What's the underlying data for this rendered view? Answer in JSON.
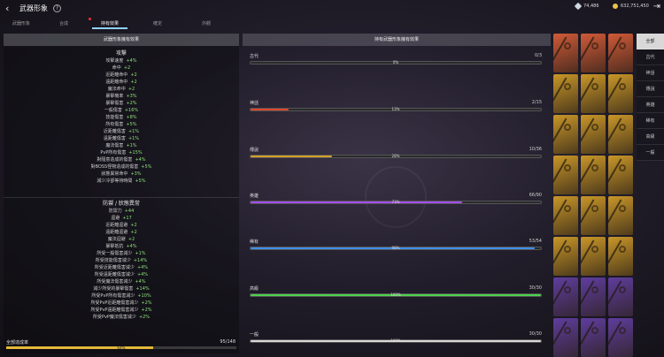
{
  "header": {
    "title": "武器形象",
    "back_icon": "‹",
    "help_icon": "?"
  },
  "currency": [
    {
      "value": "74,486",
      "color": "#cfd8e0",
      "icon": "diamond-icon"
    },
    {
      "value": "632,751,450",
      "color": "#e8c44a",
      "icon": "coin-icon"
    }
  ],
  "tabs": [
    {
      "label": "武器形象",
      "active": false
    },
    {
      "label": "合成",
      "active": false
    },
    {
      "label": "持有效果",
      "active": true
    },
    {
      "label": "確定",
      "active": false
    },
    {
      "label": "外觀",
      "active": false
    }
  ],
  "left_panel": {
    "header": "武器形象擁有效果",
    "attack_title": "攻擊",
    "attack_stats": [
      {
        "name": "攻擊速度",
        "value": "+4%"
      },
      {
        "name": "命中",
        "value": "+2"
      },
      {
        "name": "近距離命中",
        "value": "+2"
      },
      {
        "name": "遠距離命中",
        "value": "+2"
      },
      {
        "name": "魔法命中",
        "value": "+2"
      },
      {
        "name": "暴擊機率",
        "value": "+3%"
      },
      {
        "name": "暴擊傷害",
        "value": "+2%"
      },
      {
        "name": "一般傷害",
        "value": "+16%"
      },
      {
        "name": "技能傷害",
        "value": "+8%"
      },
      {
        "name": "所有傷害",
        "value": "+5%"
      },
      {
        "name": "近距離傷害",
        "value": "+1%"
      },
      {
        "name": "遠距離傷害",
        "value": "+1%"
      },
      {
        "name": "魔法傷害",
        "value": "+1%"
      },
      {
        "name": "PvP所有傷害",
        "value": "+15%"
      },
      {
        "name": "對隨意造成的傷害",
        "value": "+4%"
      },
      {
        "name": "對BOSS怪物造成的傷害",
        "value": "+5%"
      },
      {
        "name": "狀態異常命中",
        "value": "+3%"
      },
      {
        "name": "減少冷卻等待時間",
        "value": "+5%"
      }
    ],
    "defense_title": "防禦 / 狀態異常",
    "defense_stats": [
      {
        "name": "防禦力",
        "value": "+44"
      },
      {
        "name": "迴避",
        "value": "+17"
      },
      {
        "name": "近距離迴避",
        "value": "+2"
      },
      {
        "name": "遠距離迴避",
        "value": "+2"
      },
      {
        "name": "魔法迴避",
        "value": "+2"
      },
      {
        "name": "暴擊抵抗",
        "value": "+4%"
      },
      {
        "name": "所受一般傷害減少",
        "value": "+1%"
      },
      {
        "name": "所受技能傷害減少",
        "value": "+14%"
      },
      {
        "name": "所受近距離傷害減少",
        "value": "+4%"
      },
      {
        "name": "所受遠距離傷害減少",
        "value": "+4%"
      },
      {
        "name": "所受魔法傷害減少",
        "value": "+4%"
      },
      {
        "name": "減少所受的暴擊傷害",
        "value": "+14%"
      },
      {
        "name": "所受PvP所有傷害減少",
        "value": "+10%"
      },
      {
        "name": "所受PvP近距離傷害減少",
        "value": "+2%"
      },
      {
        "name": "所受PvP遠距離傷害減少",
        "value": "+2%"
      },
      {
        "name": "所受PvP魔法傷害減少",
        "value": "+2%"
      }
    ],
    "total": {
      "label": "全部達成率",
      "count": "95/148",
      "fraction": 0.64,
      "percent_text": "64%"
    }
  },
  "mid_panel": {
    "header": "持有武器形象擁有效果",
    "grades": [
      {
        "name": "古代",
        "count": "0/3",
        "percent": 0,
        "percent_text": "0%",
        "color": "#8a8a8a"
      },
      {
        "name": "神話",
        "count": "2/15",
        "percent": 13,
        "percent_text": "13%",
        "color": "#e0452e"
      },
      {
        "name": "傳說",
        "count": "10/36",
        "percent": 28,
        "percent_text": "28%",
        "color": "#d4a12a"
      },
      {
        "name": "英雄",
        "count": "66/90",
        "percent": 73,
        "percent_text": "73%",
        "color": "#a64df0"
      },
      {
        "name": "稀有",
        "count": "53/54",
        "percent": 98,
        "percent_text": "98%",
        "color": "#3f8ee8"
      },
      {
        "name": "高級",
        "count": "30/30",
        "percent": 100,
        "percent_text": "100%",
        "color": "#4bd34b"
      },
      {
        "name": "一般",
        "count": "30/30",
        "percent": 100,
        "percent_text": "100%",
        "color": "#d8d8d8"
      }
    ]
  },
  "grid_rarities": [
    "mythic",
    "mythic",
    "mythic",
    "legend",
    "legend",
    "legend",
    "legend",
    "legend",
    "legend",
    "legend",
    "legend",
    "legend",
    "legend",
    "legend",
    "legend",
    "legend",
    "legend",
    "legend",
    "hero",
    "hero",
    "hero",
    "hero",
    "hero",
    "hero"
  ],
  "rarity_colors": {
    "mythic": "#d05a38",
    "legend": "#c99628",
    "hero": "#5f3d9e"
  },
  "filters": [
    {
      "label": "全部",
      "active": true
    },
    {
      "label": "古代",
      "active": false
    },
    {
      "label": "神話",
      "active": false
    },
    {
      "label": "傳說",
      "active": false
    },
    {
      "label": "英雄",
      "active": false
    },
    {
      "label": "稀有",
      "active": false
    },
    {
      "label": "高級",
      "active": false
    },
    {
      "label": "一般",
      "active": false
    }
  ]
}
